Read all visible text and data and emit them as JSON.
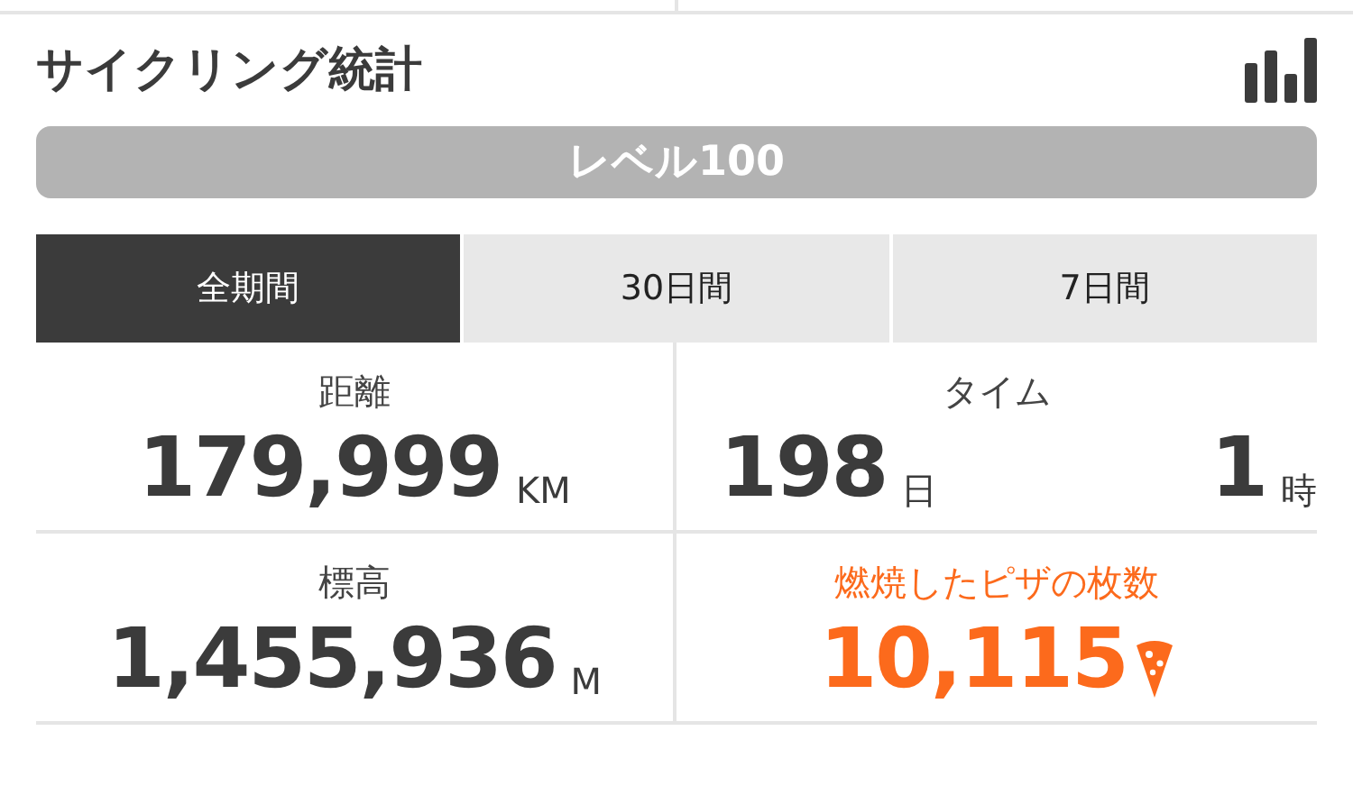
{
  "title": "サイクリング統計",
  "level_label": "レベル100",
  "tabs": [
    {
      "label": "全期間",
      "selected": true
    },
    {
      "label": "30日間",
      "selected": false
    },
    {
      "label": "7日間",
      "selected": false
    }
  ],
  "stats": [
    {
      "kind": "plain",
      "label": "距離",
      "parts": [
        {
          "value": "179,999",
          "unit": "KM"
        }
      ]
    },
    {
      "kind": "plain",
      "label": "タイム",
      "parts": [
        {
          "value": "198",
          "unit": "日"
        },
        {
          "value": "1",
          "unit": "時"
        }
      ]
    },
    {
      "kind": "plain",
      "label": "標高",
      "parts": [
        {
          "value": "1,455,936",
          "unit": "M"
        }
      ]
    },
    {
      "kind": "pizza",
      "label": "燃焼したピザの枚数",
      "parts": [
        {
          "value": "10,115"
        }
      ]
    }
  ]
}
